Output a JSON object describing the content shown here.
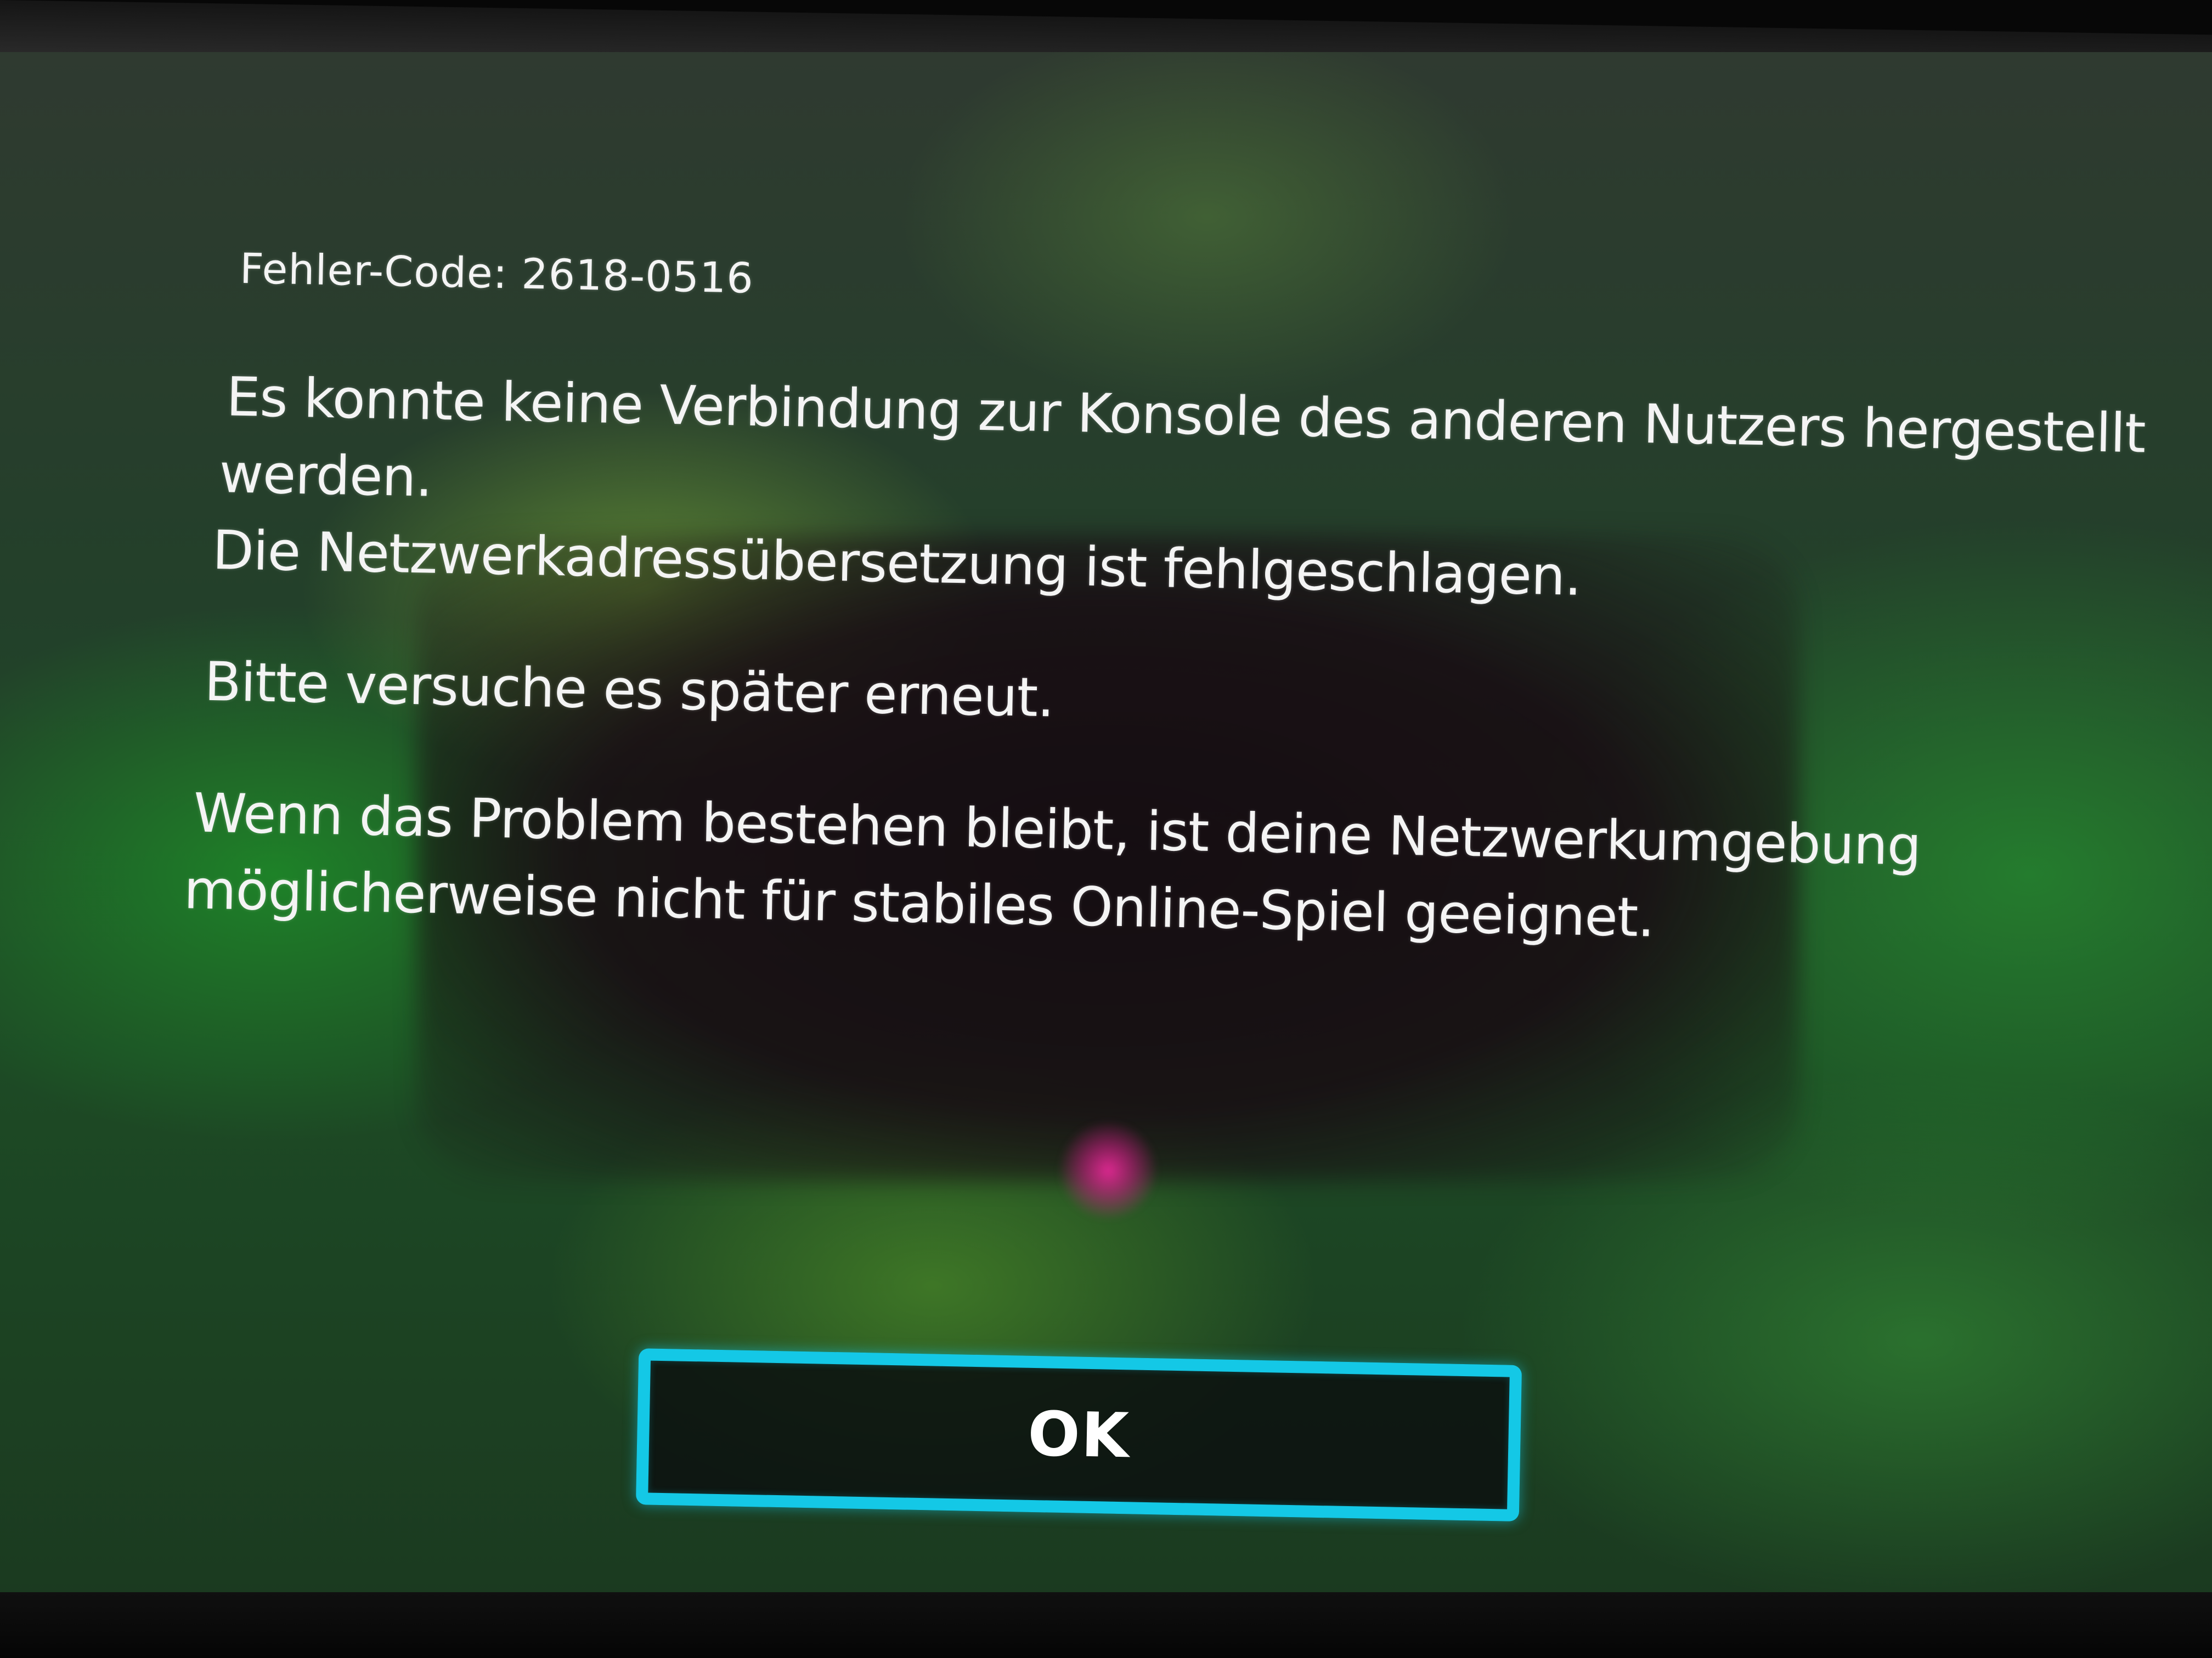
{
  "dialog": {
    "error_code": "Fehler-Code: 2618-0516",
    "message_lines": [
      "Es konnte keine Verbindung zur Konsole des anderen Nutzers hergestellt",
      "werden.",
      "Die Netzwerkadressübersetzung ist fehlgeschlagen.",
      "Bitte versuche es später erneut.",
      "Wenn das Problem bestehen bleibt, ist deine Netzwerkumgebung",
      "möglicherweise nicht für stabiles Online-Spiel geeignet."
    ],
    "ok_label": "OK"
  },
  "colors": {
    "button_border": "#14c8e6",
    "text": "#f4f4f4",
    "background_green": "#1d4a25"
  }
}
